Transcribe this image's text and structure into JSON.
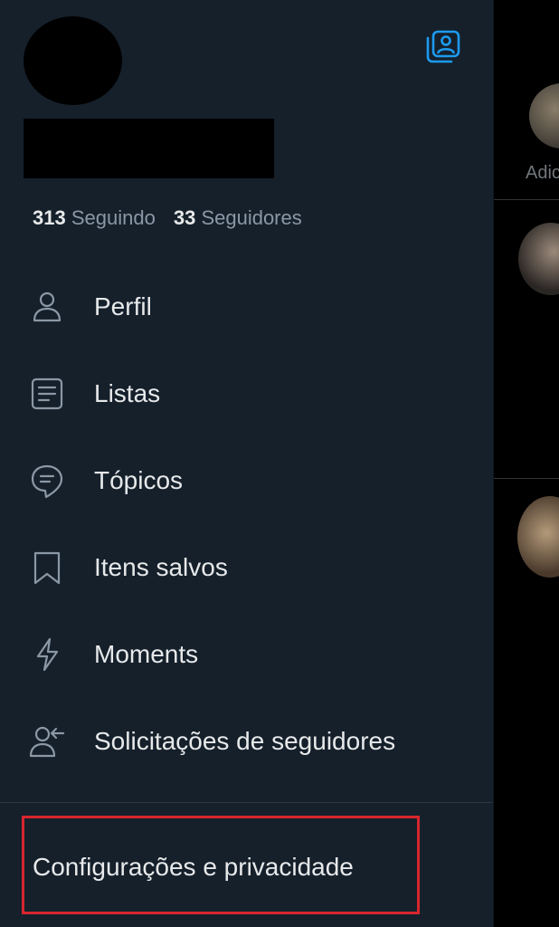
{
  "colors": {
    "drawer_background": "#15202b",
    "timeline_background": "#000000",
    "accent": "#1d9bf0",
    "primary_text": "#e7e9ea",
    "secondary_text": "#8b98a5",
    "highlight": "#d7262d"
  },
  "header": {
    "avatar": "redacted-avatar",
    "display_name": "redacted",
    "account_switch_icon": "switch-accounts-icon"
  },
  "stats": {
    "following_count": "313",
    "following_label": "Seguindo",
    "followers_count": "33",
    "followers_label": "Seguidores"
  },
  "menu": [
    {
      "label": "Perfil",
      "icon": "person-icon"
    },
    {
      "label": "Listas",
      "icon": "list-icon"
    },
    {
      "label": "Tópicos",
      "icon": "topics-icon"
    },
    {
      "label": "Itens salvos",
      "icon": "bookmark-icon"
    },
    {
      "label": "Moments",
      "icon": "lightning-icon"
    },
    {
      "label": "Solicitações de seguidores",
      "icon": "follower-requests-icon"
    }
  ],
  "footer": {
    "settings_label": "Configurações e privacidade",
    "settings_highlighted": true
  },
  "timeline_behind": {
    "partial_text": "Adic"
  }
}
